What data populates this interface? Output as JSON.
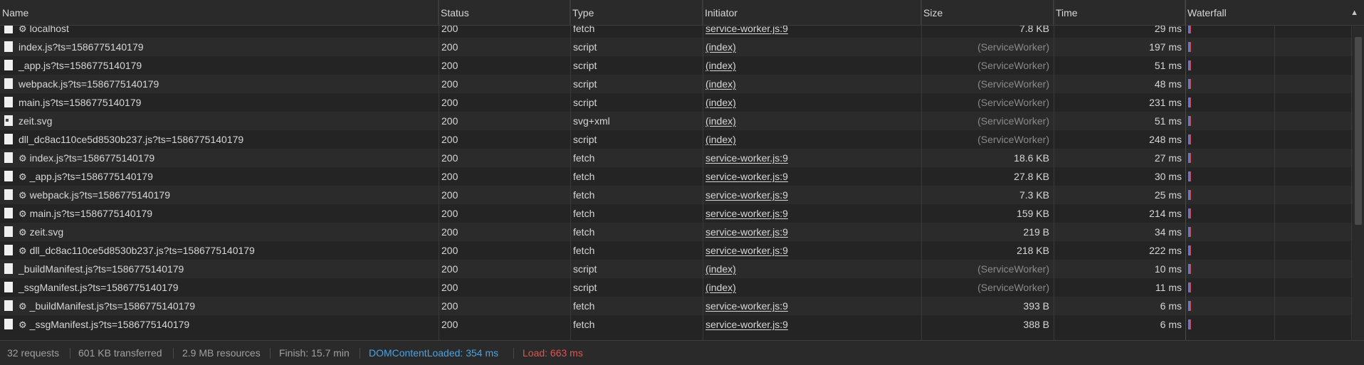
{
  "header": {
    "columns": [
      "Name",
      "Status",
      "Type",
      "Initiator",
      "Size",
      "Time",
      "Waterfall"
    ],
    "sort_indicator": "▲"
  },
  "requests": [
    {
      "name": "localhost",
      "gear": true,
      "icon": "file",
      "status": "200",
      "type": "fetch",
      "initiator": "service-worker.js:9",
      "size": "7.8 KB",
      "time": "29 ms"
    },
    {
      "name": "index.js?ts=1586775140179",
      "gear": false,
      "icon": "file",
      "status": "200",
      "type": "script",
      "initiator": "(index)",
      "size": "(ServiceWorker)",
      "time": "197 ms"
    },
    {
      "name": "_app.js?ts=1586775140179",
      "gear": false,
      "icon": "file",
      "status": "200",
      "type": "script",
      "initiator": "(index)",
      "size": "(ServiceWorker)",
      "time": "51 ms"
    },
    {
      "name": "webpack.js?ts=1586775140179",
      "gear": false,
      "icon": "file",
      "status": "200",
      "type": "script",
      "initiator": "(index)",
      "size": "(ServiceWorker)",
      "time": "48 ms"
    },
    {
      "name": "main.js?ts=1586775140179",
      "gear": false,
      "icon": "file",
      "status": "200",
      "type": "script",
      "initiator": "(index)",
      "size": "(ServiceWorker)",
      "time": "231 ms"
    },
    {
      "name": "zeit.svg",
      "gear": false,
      "icon": "svg",
      "status": "200",
      "type": "svg+xml",
      "initiator": "(index)",
      "size": "(ServiceWorker)",
      "time": "51 ms"
    },
    {
      "name": "dll_dc8ac110ce5d8530b237.js?ts=1586775140179",
      "gear": false,
      "icon": "file",
      "status": "200",
      "type": "script",
      "initiator": "(index)",
      "size": "(ServiceWorker)",
      "time": "248 ms"
    },
    {
      "name": "index.js?ts=1586775140179",
      "gear": true,
      "icon": "file",
      "status": "200",
      "type": "fetch",
      "initiator": "service-worker.js:9",
      "size": "18.6 KB",
      "time": "27 ms"
    },
    {
      "name": "_app.js?ts=1586775140179",
      "gear": true,
      "icon": "file",
      "status": "200",
      "type": "fetch",
      "initiator": "service-worker.js:9",
      "size": "27.8 KB",
      "time": "30 ms"
    },
    {
      "name": "webpack.js?ts=1586775140179",
      "gear": true,
      "icon": "file",
      "status": "200",
      "type": "fetch",
      "initiator": "service-worker.js:9",
      "size": "7.3 KB",
      "time": "25 ms"
    },
    {
      "name": "main.js?ts=1586775140179",
      "gear": true,
      "icon": "file",
      "status": "200",
      "type": "fetch",
      "initiator": "service-worker.js:9",
      "size": "159 KB",
      "time": "214 ms"
    },
    {
      "name": "zeit.svg",
      "gear": true,
      "icon": "file",
      "status": "200",
      "type": "fetch",
      "initiator": "service-worker.js:9",
      "size": "219 B",
      "time": "34 ms"
    },
    {
      "name": "dll_dc8ac110ce5d8530b237.js?ts=1586775140179",
      "gear": true,
      "icon": "file",
      "status": "200",
      "type": "fetch",
      "initiator": "service-worker.js:9",
      "size": "218 KB",
      "time": "222 ms"
    },
    {
      "name": "_buildManifest.js?ts=1586775140179",
      "gear": false,
      "icon": "file",
      "status": "200",
      "type": "script",
      "initiator": "(index)",
      "size": "(ServiceWorker)",
      "time": "10 ms"
    },
    {
      "name": "_ssgManifest.js?ts=1586775140179",
      "gear": false,
      "icon": "file",
      "status": "200",
      "type": "script",
      "initiator": "(index)",
      "size": "(ServiceWorker)",
      "time": "11 ms"
    },
    {
      "name": "_buildManifest.js?ts=1586775140179",
      "gear": true,
      "icon": "file",
      "status": "200",
      "type": "fetch",
      "initiator": "service-worker.js:9",
      "size": "393 B",
      "time": "6 ms"
    },
    {
      "name": "_ssgManifest.js?ts=1586775140179",
      "gear": true,
      "icon": "file",
      "status": "200",
      "type": "fetch",
      "initiator": "service-worker.js:9",
      "size": "388 B",
      "time": "6 ms"
    }
  ],
  "status_bar": {
    "requests": "32 requests",
    "transferred": "601 KB transferred",
    "resources": "2.9 MB resources",
    "finish": "Finish: 15.7 min",
    "dom_content_loaded": "DOMContentLoaded: 354 ms",
    "load": "Load: 663 ms"
  },
  "colors": {
    "background": "#242424",
    "row_alt": "#2b2b2b",
    "text": "#d7d7d7",
    "muted": "#8a8a8a",
    "dom_content_loaded": "#4ba3e3",
    "load": "#e0554f",
    "waterfall_blue": "#5b7fe0",
    "waterfall_red": "#d04a4a"
  }
}
